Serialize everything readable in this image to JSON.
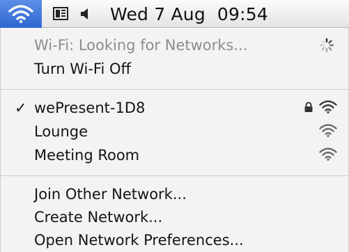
{
  "menubar": {
    "wifi_icon": "wifi-icon",
    "display_icon": "display-mirroring-icon",
    "volume_icon": "volume-icon",
    "date": "Wed 7 Aug",
    "time": "09:54",
    "accent": "#3a72da"
  },
  "status": {
    "text": "Wi-Fi: Looking for Networks...",
    "toggle_label": "Turn Wi-Fi Off"
  },
  "networks": [
    {
      "name": "wePresent-1D8",
      "connected": true,
      "secured": true,
      "check": "✓"
    },
    {
      "name": "Lounge",
      "connected": false,
      "secured": false
    },
    {
      "name": "Meeting Room",
      "connected": false,
      "secured": false
    }
  ],
  "actions": {
    "join_other": "Join Other Network...",
    "create": "Create Network...",
    "preferences": "Open Network Preferences..."
  }
}
